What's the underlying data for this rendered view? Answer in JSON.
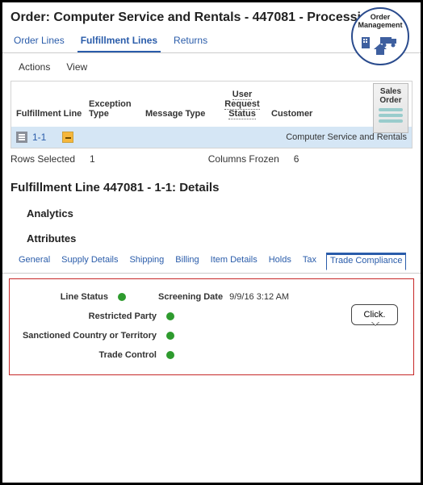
{
  "header": {
    "title": "Order: Computer Service and Rentals - 447081 - Processing",
    "badge_line1": "Order",
    "badge_line2": "Management"
  },
  "tabs_primary": [
    {
      "label": "Order Lines",
      "active": false
    },
    {
      "label": "Fulfillment Lines",
      "active": true
    },
    {
      "label": "Returns",
      "active": false
    }
  ],
  "toolbar": {
    "actions": "Actions",
    "view": "View"
  },
  "grid": {
    "columns": {
      "fulfillment_line": "Fulfillment Line",
      "exception_type": "Exception Type",
      "message_type": "Message Type",
      "user_request_status_1": "User",
      "user_request_status_2": "Request",
      "user_request_status_3": "Status",
      "customer": "Customer"
    },
    "sales_order_label_1": "Sales",
    "sales_order_label_2": "Order",
    "row": {
      "line_link": "1-1",
      "customer": "Computer Service and Rentals"
    },
    "footer": {
      "rows_selected_label": "Rows Selected",
      "rows_selected_value": "1",
      "columns_frozen_label": "Columns Frozen",
      "columns_frozen_value": "6"
    }
  },
  "details": {
    "title": "Fulfillment Line 447081 - 1-1: Details",
    "analytics": "Analytics",
    "attributes": "Attributes"
  },
  "callout_text": "Click.",
  "tabs_attributes": [
    {
      "label": "General",
      "active": false
    },
    {
      "label": "Supply Details",
      "active": false
    },
    {
      "label": "Shipping",
      "active": false
    },
    {
      "label": "Billing",
      "active": false
    },
    {
      "label": "Item Details",
      "active": false
    },
    {
      "label": "Holds",
      "active": false
    },
    {
      "label": "Tax",
      "active": false
    },
    {
      "label": "Trade Compliance",
      "active": true
    }
  ],
  "compliance": {
    "line_status_label": "Line Status",
    "screening_date_label": "Screening Date",
    "screening_date_value": "9/9/16 3:12 AM",
    "restricted_party_label": "Restricted Party",
    "sanctioned_label": "Sanctioned Country or Territory",
    "trade_control_label": "Trade Control",
    "statuses": {
      "line_status": "green",
      "restricted_party": "green",
      "sanctioned": "green",
      "trade_control": "green"
    }
  }
}
